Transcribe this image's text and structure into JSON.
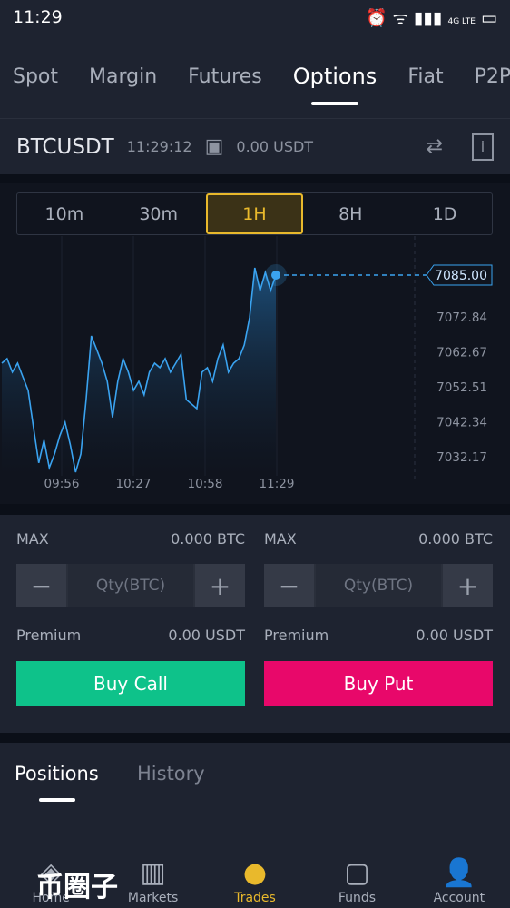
{
  "status": {
    "time": "11:29",
    "network": "4G LTE"
  },
  "tabs": [
    "Spot",
    "Margin",
    "Futures",
    "Options",
    "Fiat",
    "P2P"
  ],
  "active_tab": "Options",
  "pair": {
    "symbol": "BTCUSDT",
    "time": "11:29:12",
    "balance": "0.00 USDT"
  },
  "intervals": [
    "10m",
    "30m",
    "1H",
    "8H",
    "1D"
  ],
  "active_interval": "1H",
  "chart_data": {
    "type": "area",
    "current_price": "7085.00",
    "y_ticks": [
      "7072.84",
      "7062.67",
      "7052.51",
      "7042.34",
      "7032.17"
    ],
    "x_ticks": [
      "09:56",
      "10:27",
      "10:58",
      "11:29"
    ],
    "ylim": [
      7027,
      7090
    ],
    "values": [
      7059.4,
      7060.7,
      7056.8,
      7059.4,
      7055.4,
      7051.5,
      7040.9,
      7030.4,
      7037.0,
      7029.0,
      7033.0,
      7038.3,
      7042.2,
      7035.6,
      7027.7,
      7033.0,
      7048.8,
      7067.3,
      7063.4,
      7059.4,
      7054.1,
      7043.6,
      7054.1,
      7060.7,
      7056.8,
      7051.5,
      7054.1,
      7050.2,
      7056.8,
      7059.4,
      7058.1,
      7060.7,
      7056.8,
      7059.4,
      7062.0,
      7048.8,
      7047.5,
      7046.2,
      7056.8,
      7058.1,
      7054.1,
      7060.7,
      7064.7,
      7056.8,
      7059.4,
      7060.7,
      7064.7,
      7072.6,
      7087.1,
      7080.5,
      7085.8,
      7080.5,
      7085.0
    ],
    "line_color": "#3aa3f0"
  },
  "trade": {
    "call": {
      "max_label": "MAX",
      "max_value": "0.000 BTC",
      "qty_placeholder": "Qty(BTC)",
      "premium_label": "Premium",
      "premium_value": "0.00 USDT",
      "button": "Buy Call",
      "color": "#0ec28a"
    },
    "put": {
      "max_label": "MAX",
      "max_value": "0.000 BTC",
      "qty_placeholder": "Qty(BTC)",
      "premium_label": "Premium",
      "premium_value": "0.00 USDT",
      "button": "Buy Put",
      "color": "#e8086a"
    }
  },
  "positions_tabs": [
    "Positions",
    "History"
  ],
  "nav": [
    {
      "label": "Home",
      "icon": "home-icon"
    },
    {
      "label": "Markets",
      "icon": "markets-icon"
    },
    {
      "label": "Trades",
      "icon": "trades-icon"
    },
    {
      "label": "Funds",
      "icon": "wallet-icon"
    },
    {
      "label": "Account",
      "icon": "account-icon"
    }
  ],
  "watermark": "币圈子"
}
